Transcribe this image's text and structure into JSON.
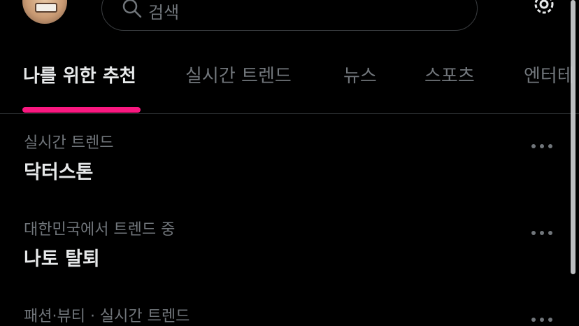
{
  "search": {
    "placeholder": "검색"
  },
  "tabs": [
    {
      "label": "나를 위한 추천",
      "active": true
    },
    {
      "label": "실시간 트렌드"
    },
    {
      "label": "뉴스"
    },
    {
      "label": "스포츠"
    },
    {
      "label": "엔터테"
    }
  ],
  "trends": [
    {
      "meta": "실시간 트렌드",
      "name": "닥터스톤"
    },
    {
      "meta": "대한민국에서 트렌드 중",
      "name": "나토 탈퇴"
    },
    {
      "meta": "패션·뷰티 · 실시간 트렌드",
      "name": ""
    }
  ],
  "icons": {
    "search": "search-icon",
    "settings": "gear-icon",
    "more": "more-options-icon"
  },
  "colors": {
    "accent": "#f91880",
    "background": "#000000",
    "muted": "#71767b"
  }
}
